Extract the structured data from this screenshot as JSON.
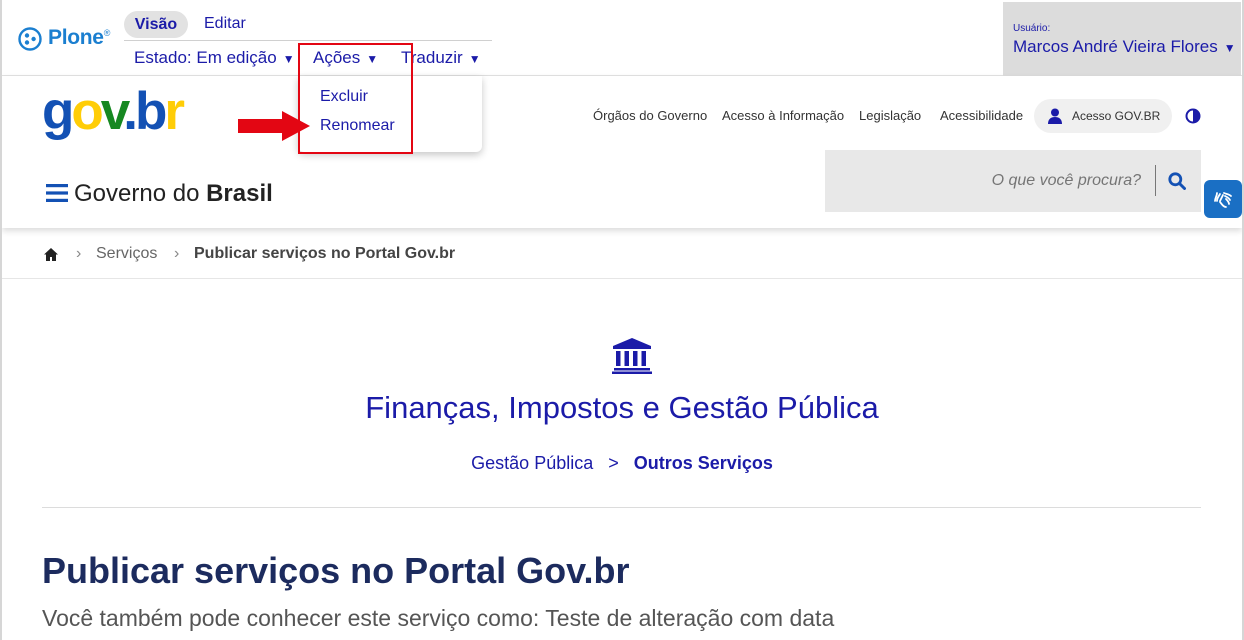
{
  "plone": {
    "logo_text": "Plone",
    "logo_mark": "®"
  },
  "toolbar": {
    "tab_view": "Visão",
    "tab_edit": "Editar",
    "state_label": "Estado: Em edição",
    "actions_label": "Ações",
    "translate_label": "Traduzir",
    "user_caption": "Usuário:",
    "user_name": "Marcos André Vieira Flores",
    "caret": "▼"
  },
  "actions_menu": {
    "items": [
      "Excluir",
      "Renomear"
    ]
  },
  "govbr": {
    "logo": "gov.br",
    "menu_title": "Governo do",
    "menu_title_bold": "Brasil"
  },
  "top_links": [
    "Órgãos do Governo",
    "Acesso à Informação",
    "Legislação",
    "Acessibilidade"
  ],
  "login_button": "Acesso GOV.BR",
  "search": {
    "placeholder": "O que você procura?"
  },
  "breadcrumb": {
    "items": [
      "Serviços",
      "Publicar serviços no Portal Gov.br"
    ],
    "sep": "›"
  },
  "category": {
    "title": "Finanças, Impostos e Gestão Pública",
    "sub_parent": "Gestão Pública",
    "sub_sep": ">",
    "sub_current": "Outros Serviços"
  },
  "page": {
    "title": "Publicar serviços no Portal Gov.br",
    "subtitle": "Você também pode conhecer este serviço como: Teste de alteração com data"
  },
  "colors": {
    "primary": "#1351b4",
    "link": "#1b1ba8",
    "dark": "#1c2b5e",
    "red": "#e30613"
  }
}
